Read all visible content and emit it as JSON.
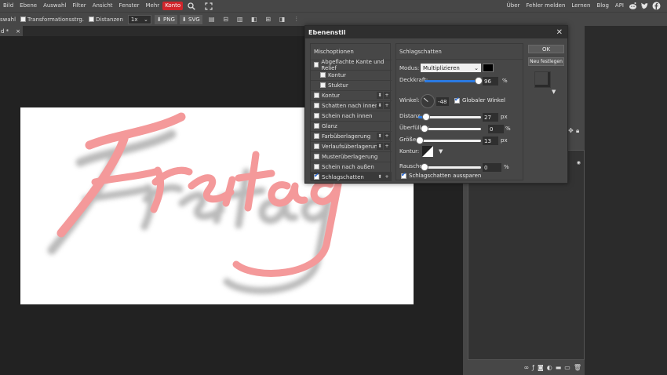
{
  "menubar": {
    "cut_label": "Bild",
    "left_items": [
      "Bild",
      "Ebene",
      "Auswahl",
      "Filter",
      "Ansicht",
      "Fenster",
      "Mehr"
    ],
    "active_item": "Konto",
    "right_items": [
      "Über",
      "Fehler melden",
      "Lernen",
      "Blog",
      "API"
    ],
    "social_icons": [
      "reddit-icon",
      "twitter-icon",
      "facebook-icon"
    ],
    "accent": "#d0252b"
  },
  "toolbar": {
    "cut_label": "swahl",
    "transform_label": "Transformationsstrg.",
    "distances_label": "Distanzen",
    "zoom_value": "1x",
    "png_label": "PNG",
    "svg_label": "SVG"
  },
  "tab": {
    "label": "d *",
    "close": "×"
  },
  "canvas": {
    "text": "Freitag",
    "text_color": "#f4999a",
    "shadow_color": "#b0b0b0"
  },
  "dialog": {
    "title": "Ebenenstil",
    "blend_header": "Mischoptionen",
    "styles": [
      {
        "label": "Abgeflachte Kante und Relief",
        "indent": false,
        "checked": false,
        "controls": false
      },
      {
        "label": "Kontur",
        "indent": true,
        "checked": false,
        "controls": false
      },
      {
        "label": "Stuktur",
        "indent": true,
        "checked": false,
        "controls": false
      },
      {
        "label": "Kontur",
        "indent": false,
        "checked": false,
        "controls": true
      },
      {
        "label": "Schatten nach innen",
        "indent": false,
        "checked": false,
        "controls": true
      },
      {
        "label": "Schein nach innen",
        "indent": false,
        "checked": false,
        "controls": false
      },
      {
        "label": "Glanz",
        "indent": false,
        "checked": false,
        "controls": false
      },
      {
        "label": "Farbüberlagerung",
        "indent": false,
        "checked": false,
        "controls": true
      },
      {
        "label": "Verlaufsüberlagerung",
        "indent": false,
        "checked": false,
        "controls": true
      },
      {
        "label": "Musterüberlagerung",
        "indent": false,
        "checked": false,
        "controls": false
      },
      {
        "label": "Schein nach außen",
        "indent": false,
        "checked": false,
        "controls": false
      },
      {
        "label": "Schlagschatten",
        "indent": false,
        "checked": true,
        "controls": true
      }
    ],
    "panel_title": "Schlagschatten",
    "mode_label": "Modus:",
    "mode_value": "Multiplizieren",
    "shadow_color": "#000000",
    "opacity_label": "Deckkraft:",
    "opacity_value": "96",
    "opacity_fraction": 0.96,
    "angle_label": "Winkel:",
    "angle_value": "-48",
    "global_angle_label": "Globaler Winkel",
    "distance_label": "Distanz:",
    "distance_value": "27",
    "distance_fraction": 0.13,
    "spread_label": "Überfüllen:",
    "spread_value": "0",
    "spread_fraction": 0.0,
    "size_label": "Größe:",
    "size_value": "13",
    "size_fraction": 0.03,
    "contour_label": "Kontur:",
    "noise_label": "Rauschen:",
    "noise_value": "0",
    "noise_fraction": 0.0,
    "knockout_label": "Schlagschatten aussparen",
    "unit_percent": "%",
    "unit_px": "px",
    "ok_label": "OK",
    "new_label": "Neu festlegen"
  },
  "layers": {
    "footer_icons": [
      "link-icon",
      "eff-icon",
      "mask-icon",
      "adjust-icon",
      "folder-icon",
      "new-layer-icon",
      "trash-icon"
    ]
  }
}
